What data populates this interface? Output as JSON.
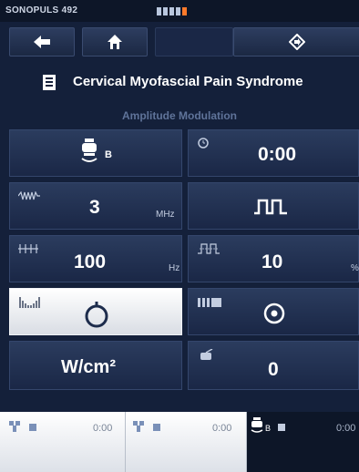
{
  "device": {
    "name": "SONOPULS 492",
    "battery_segments": 5
  },
  "nav": {
    "back_icon": "arrow-left-icon",
    "home_icon": "home-icon",
    "forward_icon": "forward-diamond-icon"
  },
  "header": {
    "title": "Cervical Myofascial Pain Syndrome",
    "subtitle": "Amplitude Modulation"
  },
  "tiles": {
    "head": {
      "label": "B"
    },
    "time": {
      "value": "0:00"
    },
    "frequency": {
      "value": "3",
      "unit": "MHz"
    },
    "pulse_mode": {
      "icon": "pulse-wave-icon"
    },
    "mod_frequency": {
      "value": "100",
      "unit": "Hz"
    },
    "duty_cycle": {
      "value": "10",
      "unit": "%"
    },
    "intensity_unit": {
      "value": "W/cm²"
    },
    "head_contact": {
      "value": "0"
    }
  },
  "channels": [
    {
      "time": "0:00"
    },
    {
      "time": "0:00"
    },
    {
      "label": "B",
      "time": "0:00"
    }
  ],
  "colors": {
    "accent_orange": "#ff7a2a",
    "panel": "#1a2746",
    "background": "#14203a"
  }
}
